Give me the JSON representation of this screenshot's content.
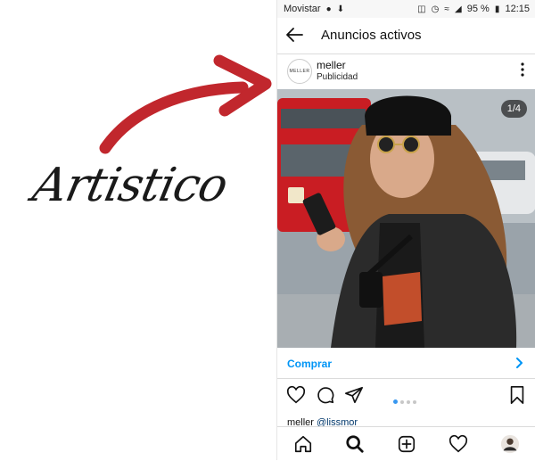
{
  "overlay": {
    "handwritten_word": "Artistico",
    "arrow_color": "#c1272d"
  },
  "statusbar": {
    "carrier": "Movistar",
    "battery": "95 %",
    "time": "12:15"
  },
  "appbar": {
    "title": "Anuncios activos",
    "back_icon": "arrow-left-icon"
  },
  "post": {
    "username": "meller",
    "avatar_text": "MELLER",
    "sponsored_label": "Publicidad",
    "image_counter": "1/4",
    "cta_label": "Comprar",
    "caption_user": "meller",
    "caption_mention": "@lissmor"
  },
  "carousel": {
    "count": 4,
    "active_index": 0
  },
  "colors": {
    "accent_blue": "#0095f6",
    "dot_active": "#3897f0",
    "statusbar_bg": "#f7f7f7"
  },
  "tabbar": {
    "icons": [
      "home-icon",
      "search-icon",
      "new-post-icon",
      "activity-heart-icon",
      "profile-avatar"
    ]
  }
}
